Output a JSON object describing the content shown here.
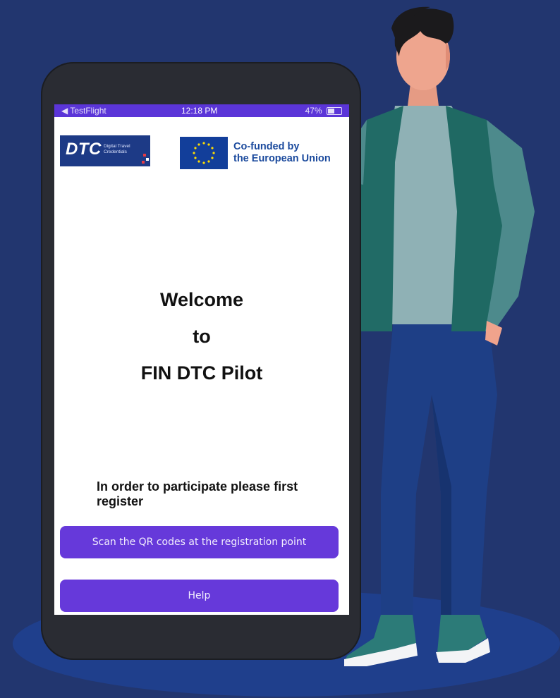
{
  "status_bar": {
    "back_app": "◀ TestFlight",
    "time": "12:18 PM",
    "battery": "47%"
  },
  "logos": {
    "dtc_mark": "DTC",
    "dtc_subtitle_line1": "Digital Travel",
    "dtc_subtitle_line2": "Credentials",
    "eu_line1": "Co-funded by",
    "eu_line2": "the European Union"
  },
  "welcome": {
    "line1": "Welcome",
    "line2": "to",
    "line3": "FIN DTC Pilot"
  },
  "register": {
    "text": "In order to participate please first register"
  },
  "buttons": {
    "scan_label": "Scan the QR codes at the registration point",
    "help_label": "Help"
  },
  "colors": {
    "background": "#22366f",
    "accent": "#6639da",
    "status_bar": "#5b35d8",
    "eu_blue": "#123e9a"
  }
}
